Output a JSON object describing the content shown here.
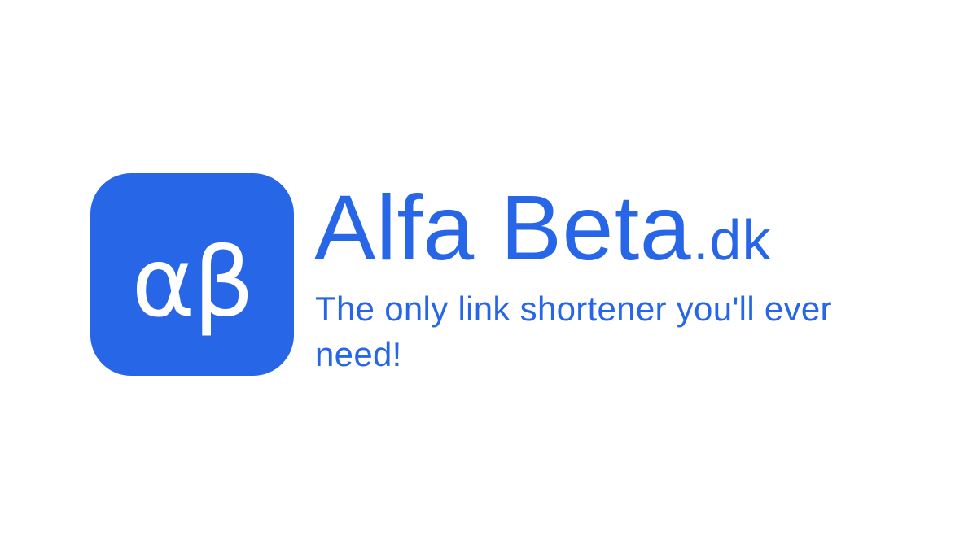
{
  "brand": {
    "logo_text": "αβ",
    "name": "Alfa Beta",
    "tld": ".dk",
    "tagline": "The only link shortener you'll ever need!",
    "accent_color": "#2866e8",
    "background_color": "#ffffff"
  }
}
